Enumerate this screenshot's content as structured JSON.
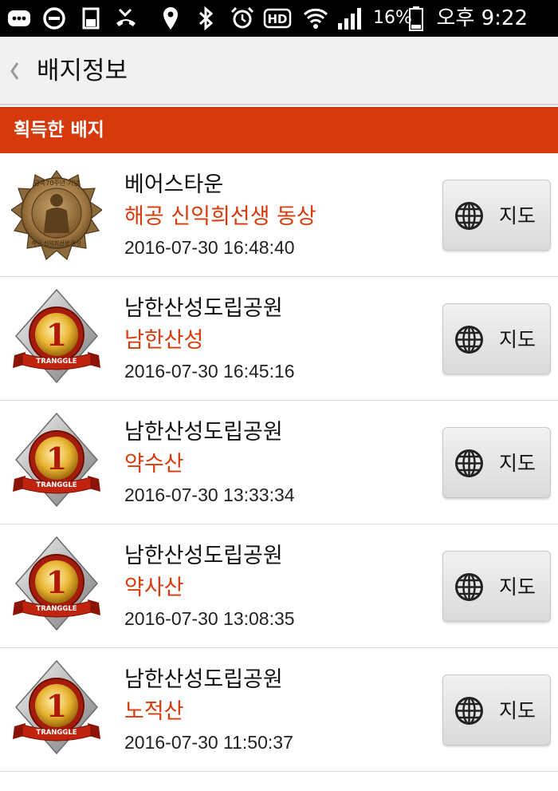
{
  "status_bar": {
    "battery_percent": "16%",
    "time": "오후 9:22",
    "icons": [
      "message-icon",
      "minus-circle-icon",
      "sd-card-icon",
      "missed-call-icon",
      "location-icon",
      "bluetooth-icon",
      "alarm-icon",
      "hd-voice-icon",
      "wifi-icon",
      "signal-icon",
      "battery-icon"
    ]
  },
  "app_bar": {
    "back_icon": "chevron-left-icon",
    "title": "배지정보"
  },
  "section": {
    "title": "획득한 배지"
  },
  "badges": [
    {
      "place": "베어스타운",
      "name": "해공 신익희선생 동상",
      "time": "2016-07-30 16:48:40",
      "image": "commemorative-medal-icon",
      "map_label": "지도"
    },
    {
      "place": "남한산성도립공원",
      "name": "남한산성",
      "time": "2016-07-30 16:45:16",
      "image": "tranggle-rank-1-badge-icon",
      "map_label": "지도"
    },
    {
      "place": "남한산성도립공원",
      "name": "약수산",
      "time": "2016-07-30 13:33:34",
      "image": "tranggle-rank-1-badge-icon",
      "map_label": "지도"
    },
    {
      "place": "남한산성도립공원",
      "name": "약사산",
      "time": "2016-07-30 13:08:35",
      "image": "tranggle-rank-1-badge-icon",
      "map_label": "지도"
    },
    {
      "place": "남한산성도립공원",
      "name": "노적산",
      "time": "2016-07-30 11:50:37",
      "image": "tranggle-rank-1-badge-icon",
      "map_label": "지도"
    }
  ],
  "badge_text": {
    "tranggle": "TRANGGLE",
    "rank": "1",
    "medal_top": "광복70주년 기념",
    "medal_bottom": "해공 신익희선생 동상"
  },
  "colors": {
    "accent": "#d63a0c",
    "badge_name": "#d93a0b",
    "app_bar": "#f1f1f1"
  }
}
